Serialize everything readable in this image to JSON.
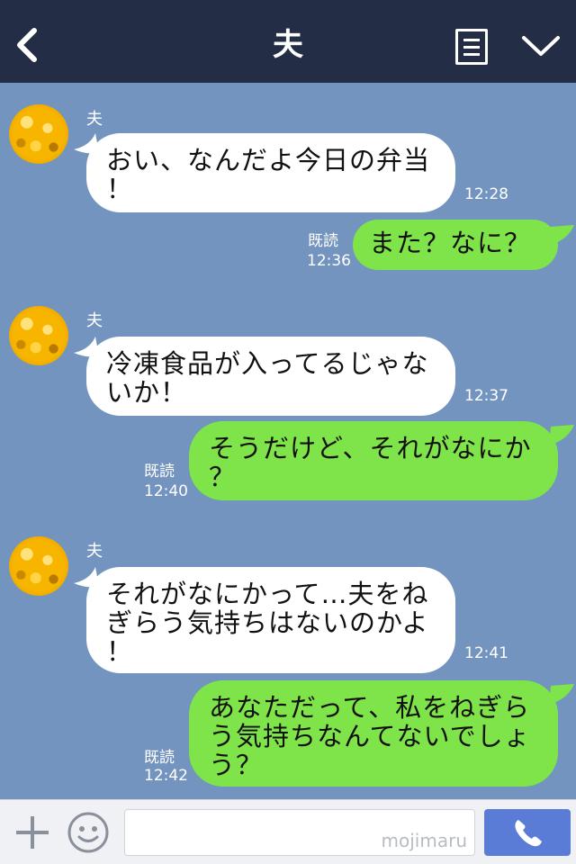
{
  "header": {
    "title": "夫",
    "icons": {
      "back": "chevron-left-icon",
      "menu": "menu-list-icon",
      "collapse": "chevron-down-icon"
    }
  },
  "messages": [
    {
      "sender": "夫",
      "lines": [
        "おい、なんだよ今日の弁当",
        "！"
      ],
      "time": "12:28"
    },
    {
      "read": "既読",
      "time": "12:36",
      "lines": [
        "また？なに？"
      ]
    },
    {
      "sender": "夫",
      "lines": [
        "冷凍食品が入ってるじゃな",
        "いか！"
      ],
      "time": "12:37"
    },
    {
      "read": "既読",
      "time": "12:40",
      "lines": [
        "そうだけど、それがなにか",
        "？"
      ]
    },
    {
      "sender": "夫",
      "lines": [
        "それがなにかって…夫をね",
        "ぎらう気持ちはないのかよ",
        "！"
      ],
      "time": "12:41"
    },
    {
      "read": "既読",
      "time": "12:42",
      "lines": [
        "あなただって、私をねぎら",
        "う気持ちなんてないでしょ",
        "う？"
      ]
    }
  ],
  "footer": {
    "watermark": "mojimaru",
    "icons": {
      "plus": "plus-icon",
      "emoji": "smiley-icon",
      "call": "phone-icon"
    }
  },
  "colors": {
    "header": "#232d45",
    "background": "#7494c0",
    "outgoing": "#7fe34a",
    "incoming": "#ffffff",
    "call": "#5b7cd6"
  }
}
